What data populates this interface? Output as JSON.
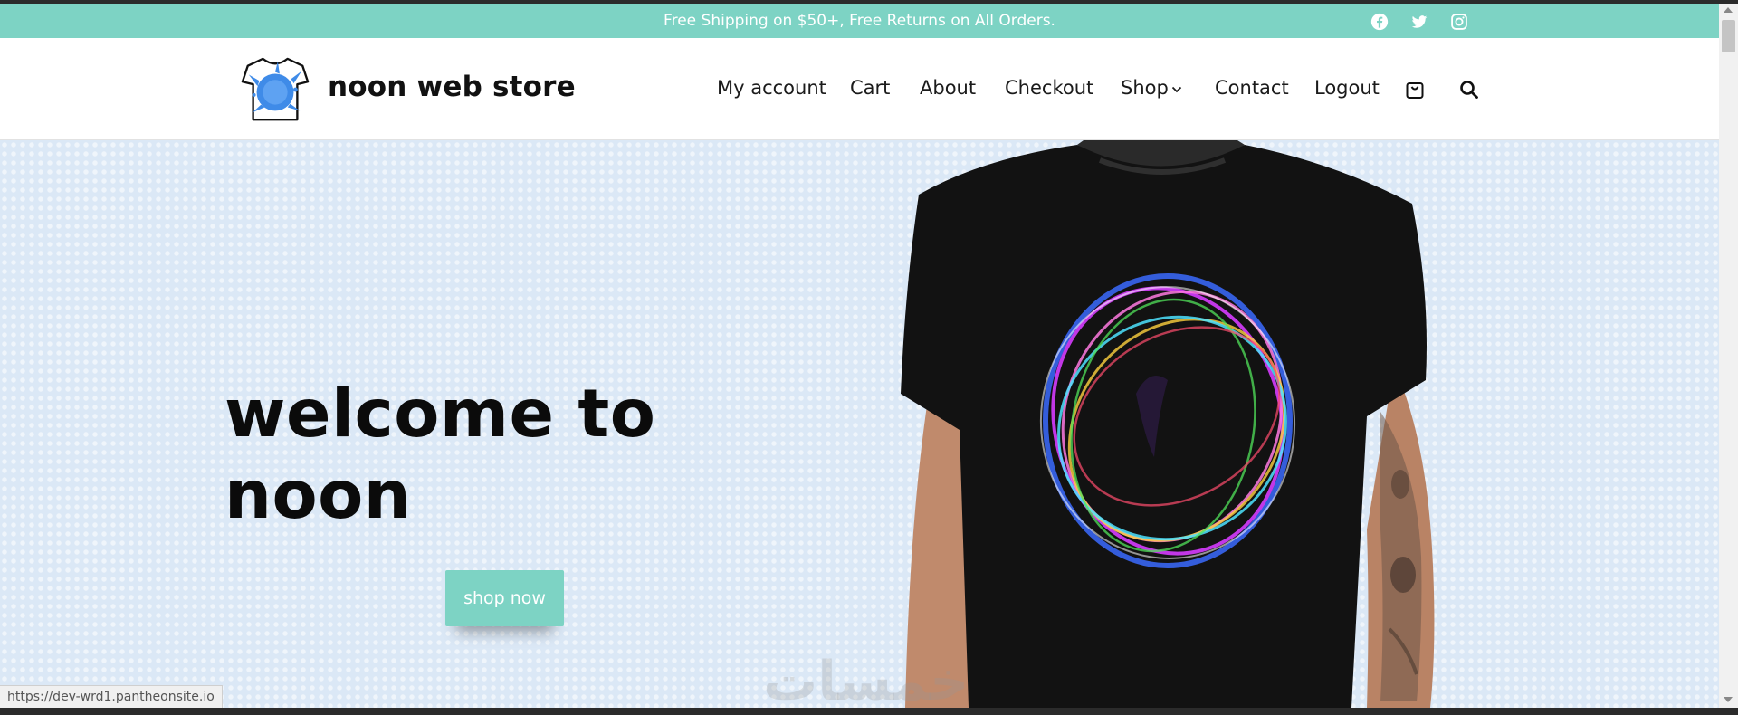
{
  "announcement": {
    "text": "Free Shipping on $50+, Free Returns on All Orders.",
    "social": [
      "facebook-icon",
      "twitter-icon",
      "instagram-icon"
    ]
  },
  "header": {
    "brand": "noon web store",
    "nav": [
      "My account",
      "Cart",
      "About",
      "Checkout",
      "Shop",
      "Contact",
      "Logout"
    ],
    "icons": [
      "shopping-bag-icon",
      "search-icon"
    ]
  },
  "hero": {
    "title_line1": "welcome to",
    "title_line2": "noon",
    "button": "shop now",
    "watermark": "خمسات"
  },
  "status": {
    "url": "https://dev-wrd1.pantheonsite.io"
  },
  "colors": {
    "accent": "#7dd3c4",
    "hero_bg": "#dbe8f6",
    "text": "#111111"
  }
}
